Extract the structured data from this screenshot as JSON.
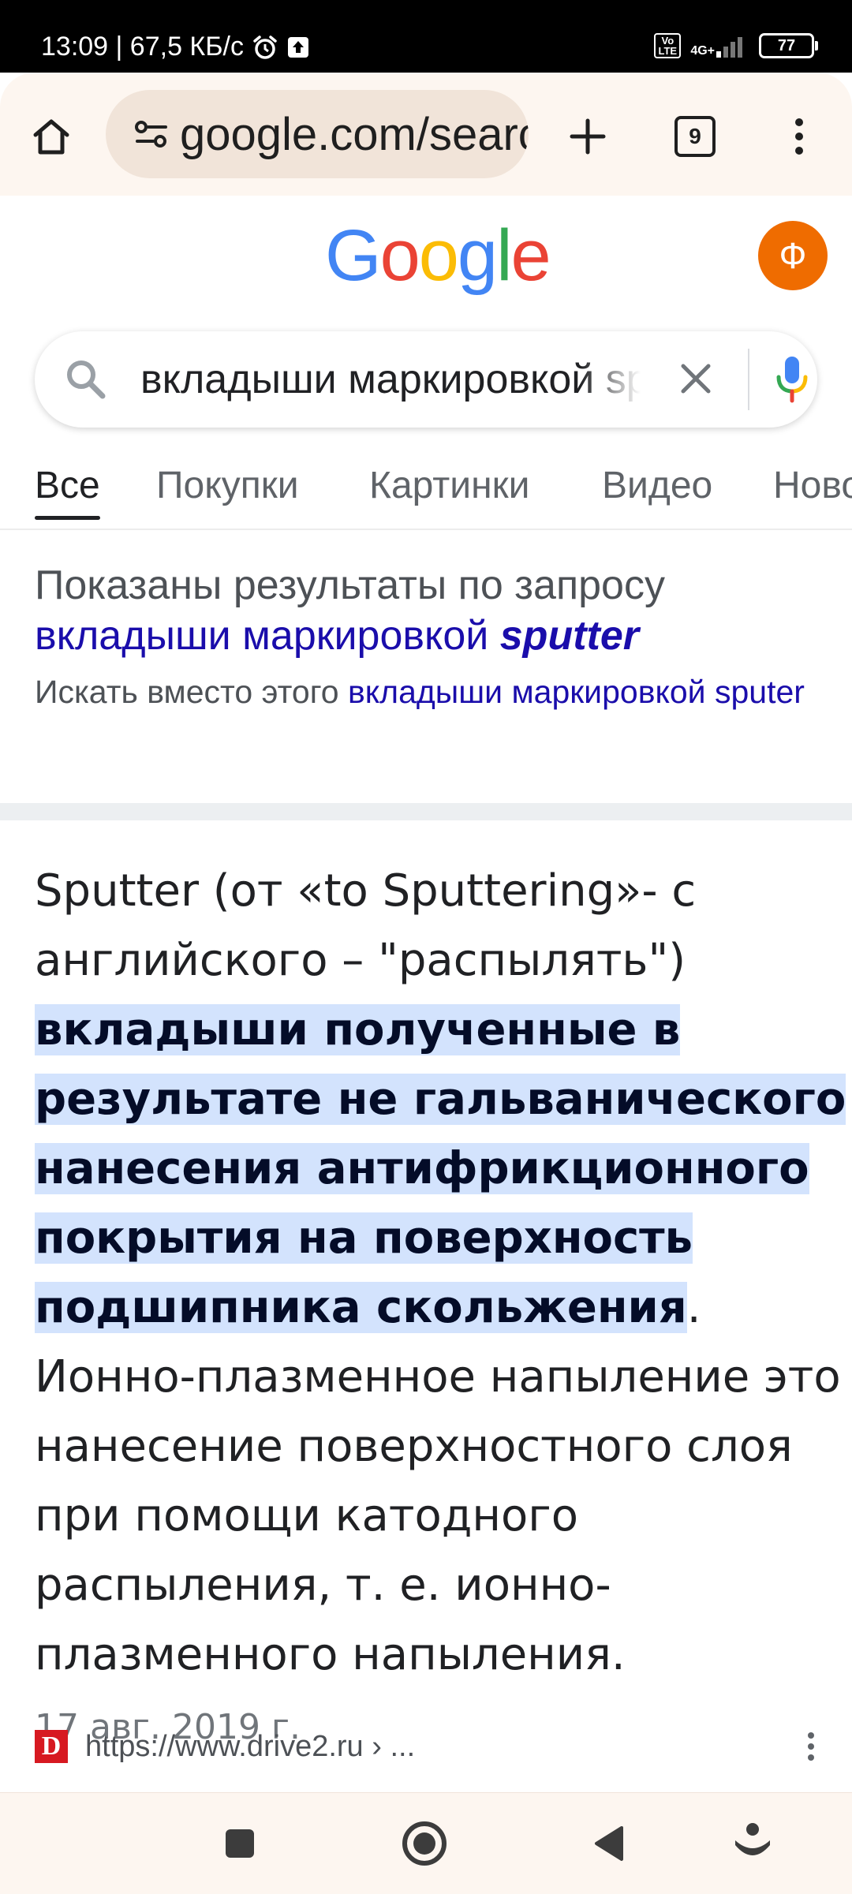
{
  "status_bar": {
    "time_speed": "13:09 | 67,5 КБ/с",
    "volte": "Vo LTE",
    "network": "4G+",
    "battery": "77"
  },
  "browser": {
    "url": "google.com/search?q=вкладыши",
    "tab_count": "9",
    "icons": [
      "home-icon",
      "site-settings-icon",
      "plus-icon",
      "tabs-icon",
      "more-vert-icon"
    ]
  },
  "google": {
    "logo_letters": [
      "G",
      "o",
      "o",
      "g",
      "l",
      "e"
    ],
    "logo_colors": [
      "#4285F4",
      "#EA4335",
      "#FBBC05",
      "#4285F4",
      "#34A853",
      "#EA4335"
    ],
    "avatar_letter": "Ф",
    "avatar_color": "#EF6C00"
  },
  "search": {
    "query": "вкладыши маркировкой sputter",
    "icons": [
      "search-icon",
      "close-icon",
      "microphone-icon"
    ]
  },
  "filter_tabs": [
    {
      "label": "Все",
      "active": true
    },
    {
      "label": "Покупки",
      "active": false
    },
    {
      "label": "Картинки",
      "active": false
    },
    {
      "label": "Видео",
      "active": false
    },
    {
      "label": "Новости",
      "active": false
    }
  ],
  "spelling": {
    "shown_results_for": "Показаны результаты по запросу",
    "corrected_query_plain": "вкладыши маркировкой",
    "corrected_query_bold": "sputter",
    "search_instead_prefix": "Искать вместо этого",
    "original_query": "вкладыши маркировкой sputer"
  },
  "snippet": {
    "intro": "Sputter (от «to Sputtering»- с английского – \"распылять\")",
    "highlight": "вкладыши полученные в результате не гальванического нанесения антифрикционного покрытия на поверхность подшипника скольжения",
    "highlight_end": ".",
    "continuation": "Ионно-плазменное напыление это нанесение поверхностного слоя при помощи катодного распыления, т. е. ионно-плазменного напыления.",
    "date": "17 авг. 2019 г."
  },
  "source": {
    "favicon_letter": "D",
    "url": "https://www.drive2.ru › ..."
  },
  "nav_bar": {
    "icons": [
      "recents-icon",
      "home-circle-icon",
      "back-icon",
      "assistant-icon"
    ]
  },
  "colors": {
    "link": "#1A0DAB",
    "highlight_bg": "#D3E3FD",
    "toolbar_bg": "#FDF6F0",
    "url_pill_bg": "#F1E4D9"
  }
}
